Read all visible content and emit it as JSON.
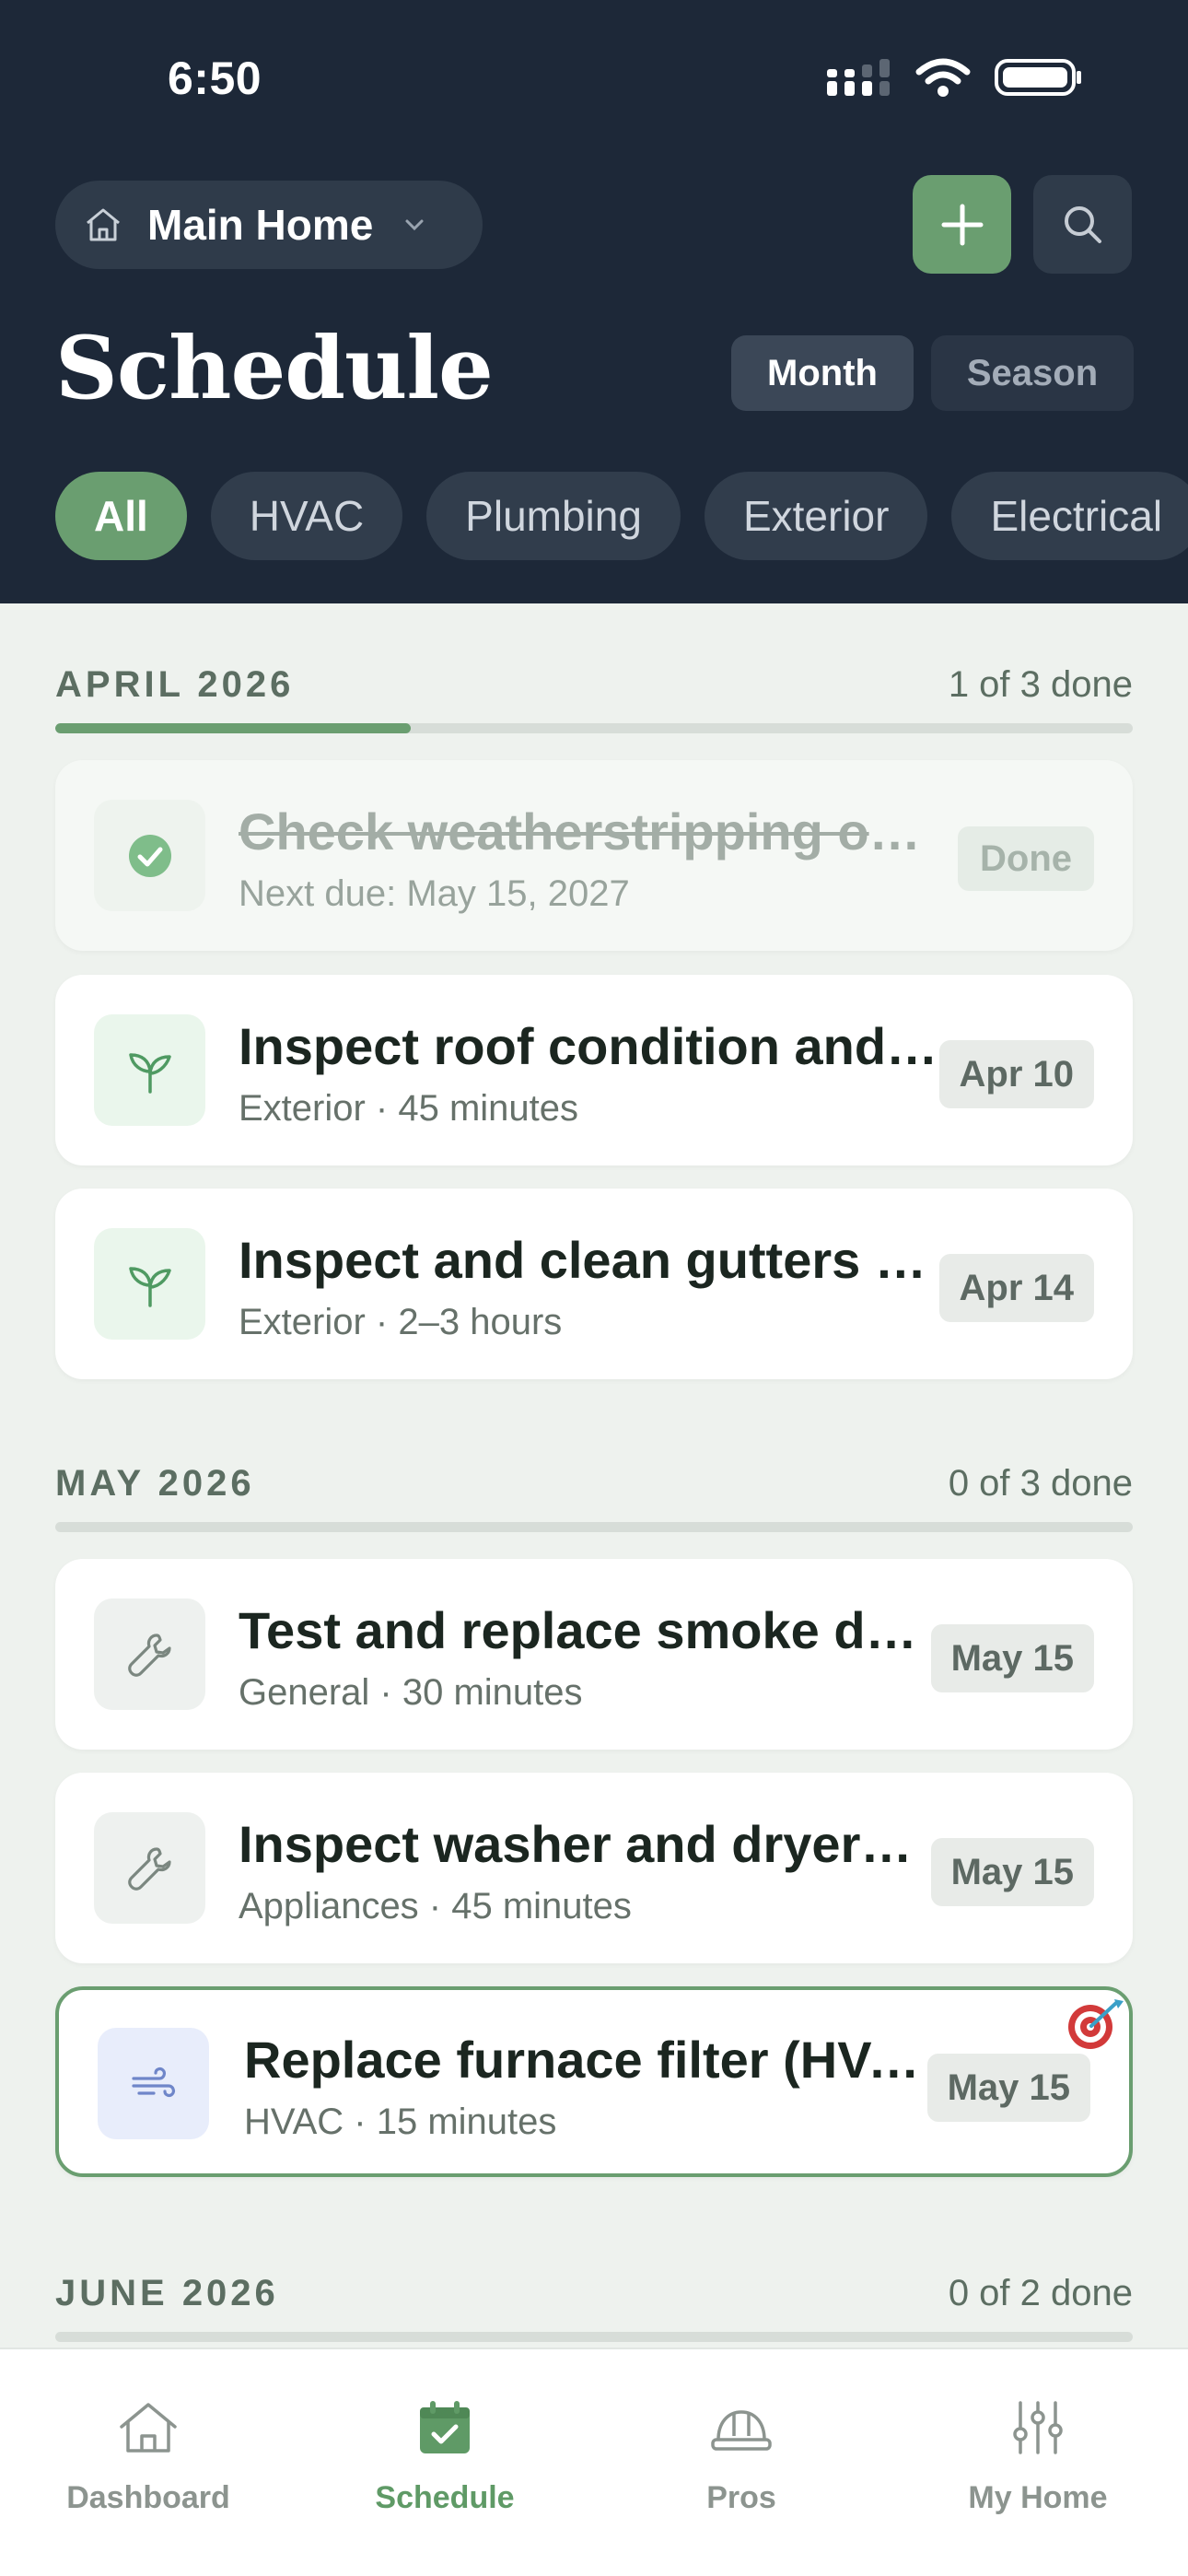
{
  "status_bar": {
    "time": "6:50"
  },
  "header": {
    "home_picker_label": "Main Home",
    "title": "Schedule",
    "view_toggle": {
      "month": "Month",
      "season": "Season",
      "selected": "Month"
    },
    "filters": [
      "All",
      "HVAC",
      "Plumbing",
      "Exterior",
      "Electrical"
    ],
    "selected_filter": "All"
  },
  "colors": {
    "accent": "#6a9e70",
    "header_bg": "#1d2838",
    "page_bg": "#eef2ee"
  },
  "sections": [
    {
      "month": "APRIL 2026",
      "count": "1 of 3 done",
      "progress": 0.33,
      "tasks": [
        {
          "title": "Check weatherstripping on doors and windows",
          "meta": "Next due: May 15, 2027",
          "badge": "Done",
          "icon": "check-circle-icon",
          "done": true
        },
        {
          "title": "Inspect roof condition and flashing",
          "meta": "Exterior · 45 minutes",
          "badge": "Apr 10",
          "icon": "leaf-icon"
        },
        {
          "title": "Inspect and clean gutters and downspouts",
          "meta": "Exterior · 2–3 hours",
          "badge": "Apr 14",
          "icon": "leaf-icon"
        }
      ]
    },
    {
      "month": "MAY 2026",
      "count": "0 of 3 done",
      "progress": 0,
      "tasks": [
        {
          "title": "Test and replace smoke detector batteries",
          "meta": "General · 30 minutes",
          "badge": "May 15",
          "icon": "wrench-icon"
        },
        {
          "title": "Inspect washer and dryer hoses",
          "meta": "Appliances · 45 minutes",
          "badge": "May 15",
          "icon": "wrench-icon"
        },
        {
          "title": "Replace furnace filter (HVAC)",
          "meta": "HVAC · 15 minutes",
          "badge": "May 15",
          "icon": "wind-icon",
          "highlighted": true,
          "marker": "target-icon"
        }
      ]
    },
    {
      "month": "JUNE 2026",
      "count": "0 of 2 done",
      "progress": 0
    }
  ],
  "tabs": [
    {
      "label": "Dashboard",
      "icon": "house-icon"
    },
    {
      "label": "Schedule",
      "icon": "calendar-check-icon",
      "active": true
    },
    {
      "label": "Pros",
      "icon": "hard-hat-icon"
    },
    {
      "label": "My Home",
      "icon": "sliders-icon"
    }
  ]
}
